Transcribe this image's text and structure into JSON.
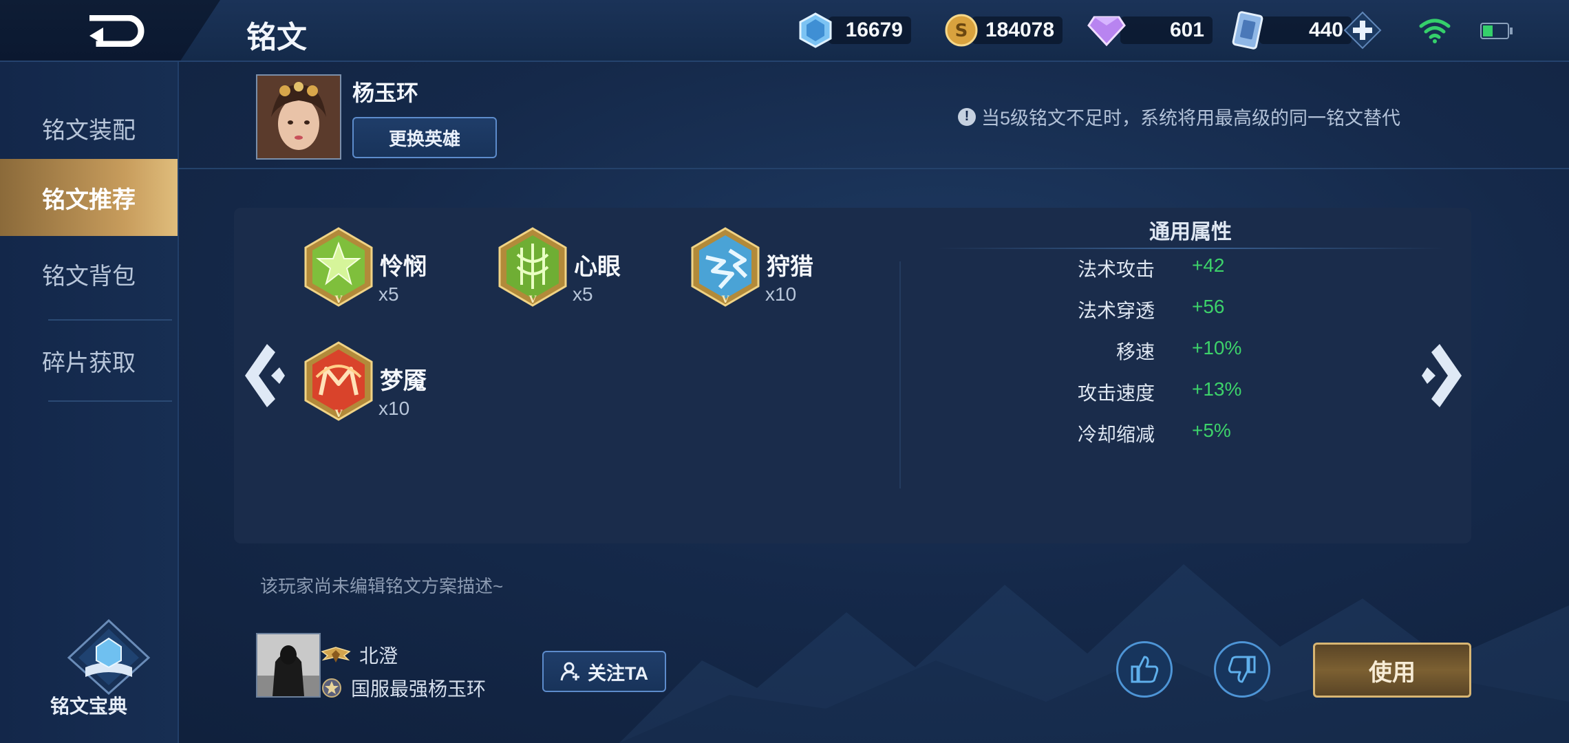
{
  "header": {
    "title": "铭文",
    "resources": [
      {
        "icon": "crystal-icon",
        "value": "16679"
      },
      {
        "icon": "gold-coin-icon",
        "value": "184078"
      },
      {
        "icon": "diamond-icon",
        "value": "601"
      },
      {
        "icon": "voucher-icon",
        "value": "440"
      }
    ],
    "status_icons": [
      "add-icon",
      "wifi-icon",
      "battery-icon"
    ]
  },
  "sidebar": {
    "items": [
      {
        "label": "铭文装配",
        "active": false
      },
      {
        "label": "铭文推荐",
        "active": true
      },
      {
        "label": "铭文背包",
        "active": false
      },
      {
        "label": "碎片获取",
        "active": false
      }
    ],
    "codex_label": "铭文宝典"
  },
  "hero": {
    "name": "杨玉环",
    "change_button": "更换英雄",
    "notice": "当5级铭文不足时，系统将用最高级的同一铭文替代"
  },
  "runes": [
    {
      "name": "怜悯",
      "count": "x5",
      "color": "green",
      "level": "V"
    },
    {
      "name": "心眼",
      "count": "x5",
      "color": "green",
      "level": "V"
    },
    {
      "name": "狩猎",
      "count": "x10",
      "color": "blue",
      "level": "V"
    },
    {
      "name": "梦魇",
      "count": "x10",
      "color": "red",
      "level": "V"
    }
  ],
  "attributes": {
    "title": "通用属性",
    "rows": [
      {
        "name": "法术攻击",
        "value": "+42"
      },
      {
        "name": "法术穿透",
        "value": "+56"
      },
      {
        "name": "移速",
        "value": "+10%"
      },
      {
        "name": "攻击速度",
        "value": "+13%"
      },
      {
        "name": "冷却缩减",
        "value": "+5%"
      }
    ]
  },
  "description": "该玩家尚未编辑铭文方案描述~",
  "author": {
    "name": "北澄",
    "title": "国服最强杨玉环",
    "follow_button": "关注TA"
  },
  "actions": {
    "use_button": "使用"
  },
  "colors": {
    "accent_gold": "#c79c5c",
    "attr_value_green": "#3dd26a",
    "button_border_blue": "#5d8ccc"
  }
}
